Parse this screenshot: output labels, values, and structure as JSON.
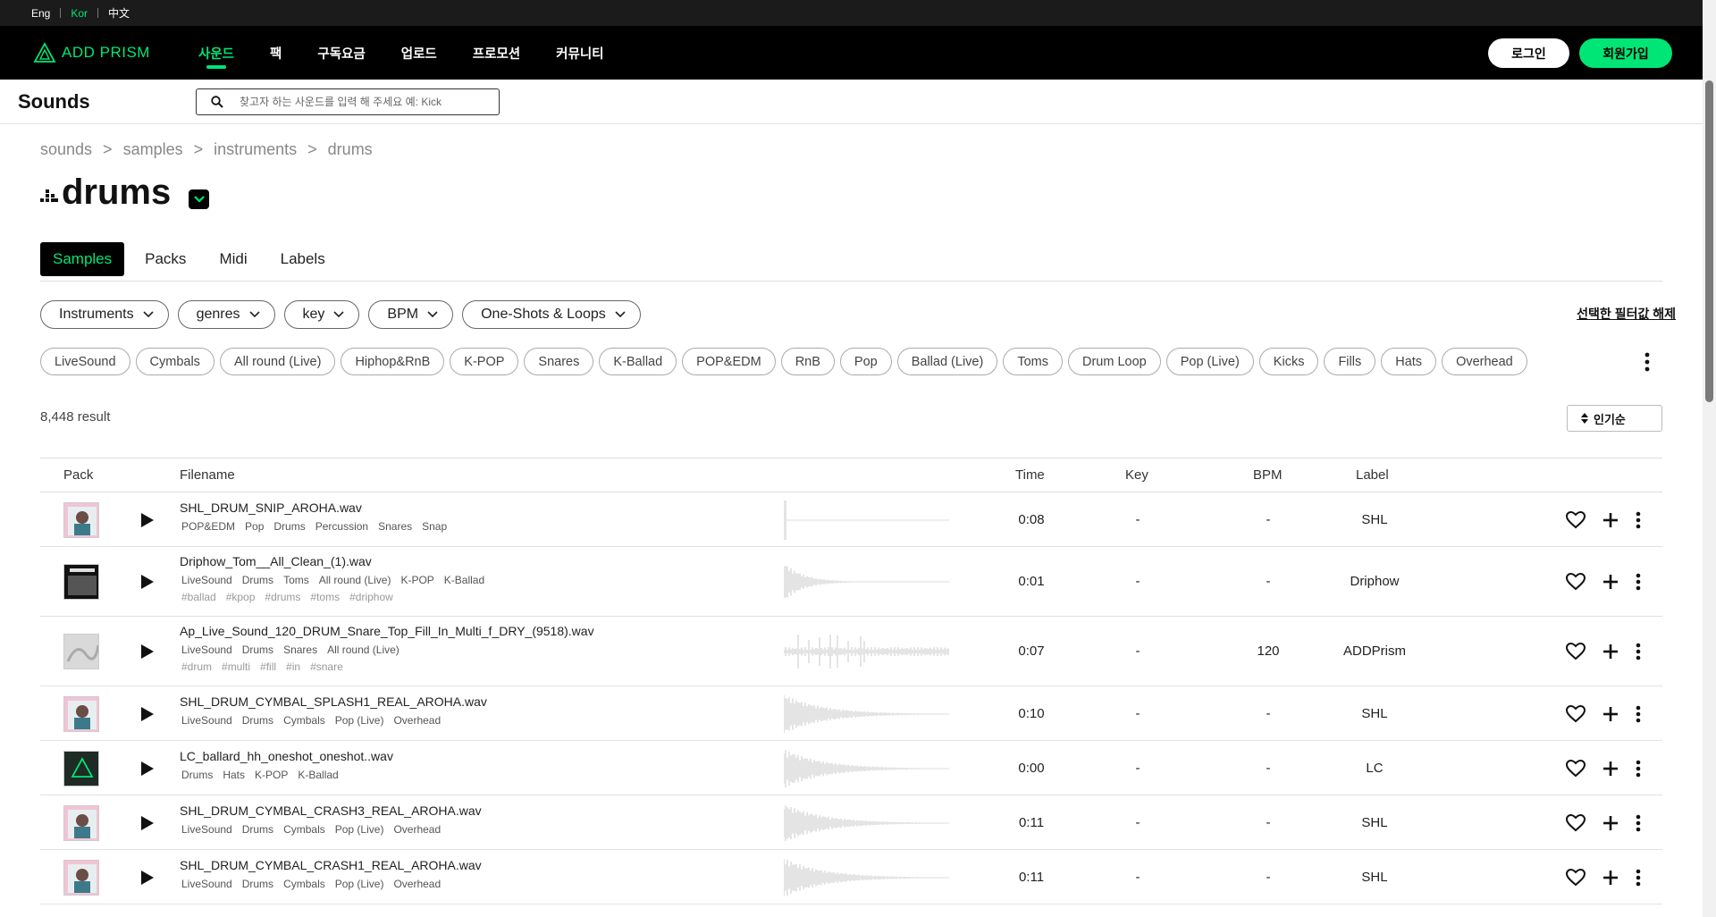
{
  "languages": [
    {
      "label": "Eng",
      "active": false
    },
    {
      "label": "Kor",
      "active": true
    },
    {
      "label": "中文",
      "active": false
    }
  ],
  "nav": {
    "logo_text": "ADD PRISM",
    "menu": [
      {
        "label": "사운드",
        "active": true
      },
      {
        "label": "팩",
        "active": false
      },
      {
        "label": "구독요금",
        "active": false
      },
      {
        "label": "업로드",
        "active": false
      },
      {
        "label": "프로모션",
        "active": false
      },
      {
        "label": "커뮤니티",
        "active": false
      }
    ],
    "login_label": "로그인",
    "signup_label": "회원가입"
  },
  "header": {
    "title": "Sounds",
    "search_placeholder": "찾고자 하는 사운드를 입력 해 주세요 예: Kick"
  },
  "breadcrumb": [
    "sounds",
    "samples",
    "instruments",
    "drums"
  ],
  "breadcrumb_separator": ">",
  "page_title": "drums",
  "tabs": [
    {
      "label": "Samples",
      "active": true
    },
    {
      "label": "Packs",
      "active": false
    },
    {
      "label": "Midi",
      "active": false
    },
    {
      "label": "Labels",
      "active": false
    }
  ],
  "filters": [
    "Instruments",
    "genres",
    "key",
    "BPM",
    "One-Shots & Loops"
  ],
  "clear_filters_label": "선택한 필터값 해제",
  "tags": [
    "LiveSound",
    "Cymbals",
    "All round (Live)",
    "Hiphop&RnB",
    "K-POP",
    "Snares",
    "K-Ballad",
    "POP&EDM",
    "RnB",
    "Pop",
    "Ballad (Live)",
    "Toms",
    "Drum Loop",
    "Pop (Live)",
    "Kicks",
    "Fills",
    "Hats",
    "Overhead"
  ],
  "result_count": "8,448 result",
  "sort_label": "인기순",
  "columns": {
    "pack": "Pack",
    "filename": "Filename",
    "time": "Time",
    "key": "Key",
    "bpm": "BPM",
    "label": "Label"
  },
  "rows": [
    {
      "filename": "SHL_DRUM_SNIP_AROHA.wav",
      "tags": [
        "POP&EDM",
        "Pop",
        "Drums",
        "Percussion",
        "Snares",
        "Snap"
      ],
      "hashtags": [],
      "time": "0:08",
      "key": "-",
      "bpm": "-",
      "label": "SHL",
      "cover": "pink"
    },
    {
      "filename": "Driphow_Tom__All_Clean_(1).wav",
      "tags": [
        "LiveSound",
        "Drums",
        "Toms",
        "All round (Live)",
        "K-POP",
        "K-Ballad"
      ],
      "hashtags": [
        "#ballad",
        "#kpop",
        "#drums",
        "#toms",
        "#driphow"
      ],
      "time": "0:01",
      "key": "-",
      "bpm": "-",
      "label": "Driphow",
      "cover": "dark"
    },
    {
      "filename": "Ap_Live_Sound_120_DRUM_Snare_Top_Fill_In_Multi_f_DRY_(9518).wav",
      "tags": [
        "LiveSound",
        "Drums",
        "Snares",
        "All round (Live)"
      ],
      "hashtags": [
        "#drum",
        "#multi",
        "#fill",
        "#in",
        "#snare"
      ],
      "time": "0:07",
      "key": "-",
      "bpm": "120",
      "label": "ADDPrism",
      "cover": "grey"
    },
    {
      "filename": "SHL_DRUM_CYMBAL_SPLASH1_REAL_AROHA.wav",
      "tags": [
        "LiveSound",
        "Drums",
        "Cymbals",
        "Pop (Live)",
        "Overhead"
      ],
      "hashtags": [],
      "time": "0:10",
      "key": "-",
      "bpm": "-",
      "label": "SHL",
      "cover": "pink"
    },
    {
      "filename": "LC_ballard_hh_oneshot_oneshot..wav",
      "tags": [
        "Drums",
        "Hats",
        "K-POP",
        "K-Ballad"
      ],
      "hashtags": [],
      "time": "0:00",
      "key": "-",
      "bpm": "-",
      "label": "LC",
      "cover": "logo"
    },
    {
      "filename": "SHL_DRUM_CYMBAL_CRASH3_REAL_AROHA.wav",
      "tags": [
        "LiveSound",
        "Drums",
        "Cymbals",
        "Pop (Live)",
        "Overhead"
      ],
      "hashtags": [],
      "time": "0:11",
      "key": "-",
      "bpm": "-",
      "label": "SHL",
      "cover": "pink"
    },
    {
      "filename": "SHL_DRUM_CYMBAL_CRASH1_REAL_AROHA.wav",
      "tags": [
        "LiveSound",
        "Drums",
        "Cymbals",
        "Pop (Live)",
        "Overhead"
      ],
      "hashtags": [],
      "time": "0:11",
      "key": "-",
      "bpm": "-",
      "label": "SHL",
      "cover": "pink"
    }
  ],
  "colors": {
    "accent": "#00e676",
    "nav_bg": "#000000",
    "lang_bg": "#1b1b1b"
  }
}
